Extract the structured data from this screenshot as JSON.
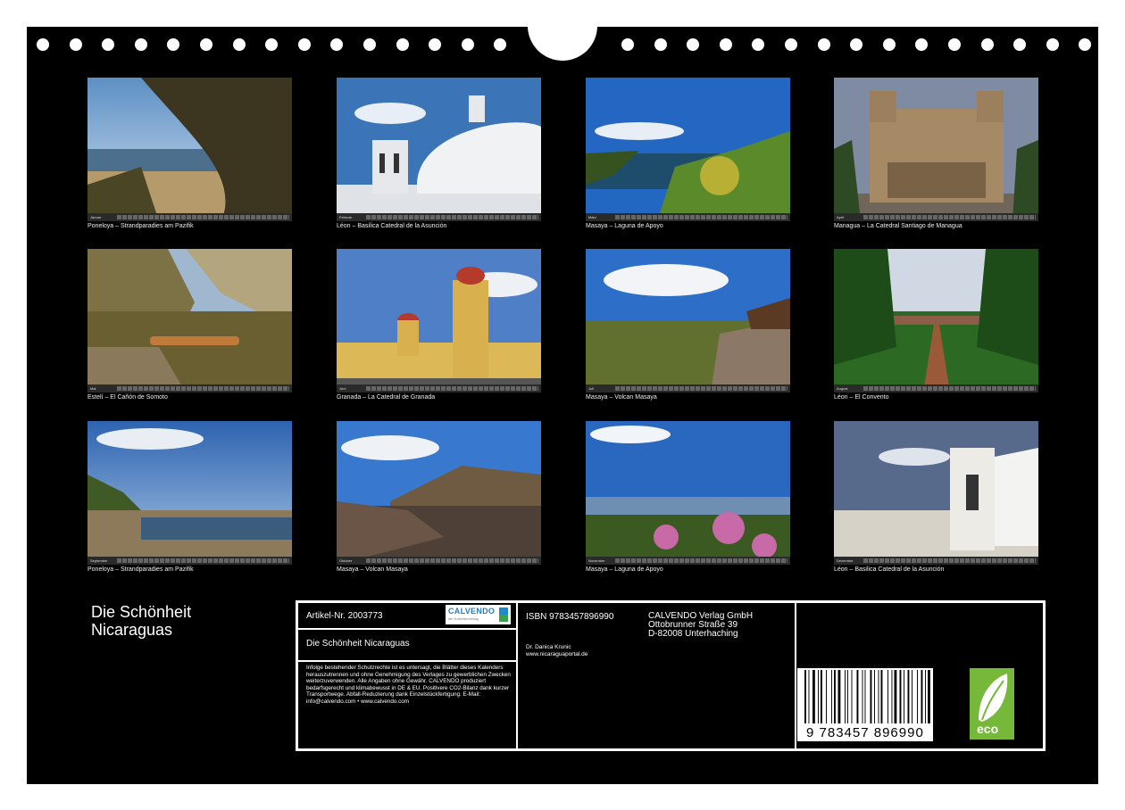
{
  "photos": [
    {
      "caption": "Poneloya – Strandparadies am Pazifik",
      "month": "Januar"
    },
    {
      "caption": "Léon – Basilica Catedral de la Asunción",
      "month": "Februar"
    },
    {
      "caption": "Masaya – Laguna de Apoyo",
      "month": "März"
    },
    {
      "caption": "Managua – La Catedral Santiago de Managua",
      "month": "April"
    },
    {
      "caption": "Estelí – El Cañón de Somoto",
      "month": "Mai"
    },
    {
      "caption": "Granada – La Catedral de Granada",
      "month": "Juni"
    },
    {
      "caption": "Masaya – Volcan Masaya",
      "month": "Juli"
    },
    {
      "caption": "Léon – El Convento",
      "month": "August"
    },
    {
      "caption": "Poneloya – Strandparadies am Pazifik",
      "month": "September"
    },
    {
      "caption": "Masaya – Volcan Masaya",
      "month": "Oktober"
    },
    {
      "caption": "Masaya – Laguna de Apoyo",
      "month": "November"
    },
    {
      "caption": "Léon – Basilica Catedral de la Asunción",
      "month": "Dezember"
    }
  ],
  "back": {
    "title_line1": "Die Schönheit",
    "title_line2": "Nicaraguas",
    "article": "Artikel-Nr. 2003773",
    "logo_text": "CALVENDO",
    "logo_sub": "der Kalenderverlag",
    "product_title": "Die Schönheit Nicaraguas",
    "legal": "Infolge bestehender Schutzrechte ist es untersagt, die Blätter dieses Kalenders herauszutrennen und ohne Genehmigung des Verlages zu gewerblichen Zwecken weiterzuverwenden. Alle Angaben ohne Gewähr. CALVENDO produziert bedarfsgerecht und klimabewusst in DE & EU. Positivere CO2-Bilanz dank kurzer Transportwege. Abfall-Reduzierung dank Einzelstückfertigung. E-Mail: info@calvendo.com • www.calvendo.com",
    "isbn": "ISBN 9783457896990",
    "author": "Dr. Danica Krunic",
    "website": "www.nicaraguaportal.de",
    "publisher_name": "CALVENDO Verlag GmbH",
    "publisher_street": "Ottobrunner Straße 39",
    "publisher_city": "D-82008 Unterhaching",
    "barcode_digits": "9 783457 896990",
    "eco_label": "eco"
  }
}
